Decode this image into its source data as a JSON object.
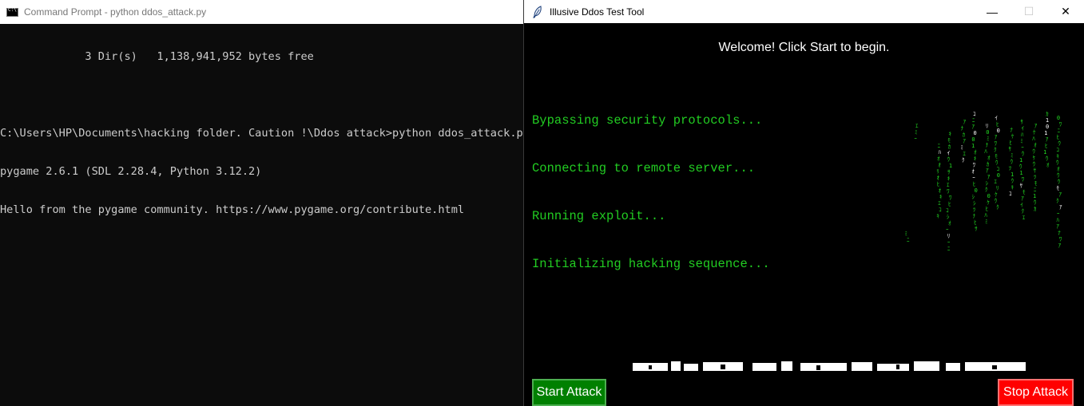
{
  "cmd": {
    "title": "Command Prompt - python  ddos_attack.py",
    "lines": [
      "             3 Dir(s)   1,138,941,952 bytes free",
      "",
      "C:\\Users\\HP\\Documents\\hacking folder. Caution !\\Ddos attack>python ddos_attack.py",
      "pygame 2.6.1 (SDL 2.28.4, Python 3.12.2)",
      "Hello from the pygame community. https://www.pygame.org/contribute.html"
    ]
  },
  "app": {
    "title": "Illusive Ddos Test Tool",
    "window_controls": {
      "minimize": "—",
      "maximize": "☐",
      "close": "✕"
    },
    "welcome": "Welcome! Click Start to begin.",
    "log": [
      "Bypassing security protocols...",
      "Connecting to remote server...",
      "Running exploit...",
      "Initializing hacking sequence..."
    ],
    "buttons": {
      "start": "Start Attack",
      "stop": "Stop Attack"
    },
    "colors": {
      "log_text": "#22cc22",
      "start_bg": "#008000",
      "stop_bg": "#ff0000"
    }
  }
}
